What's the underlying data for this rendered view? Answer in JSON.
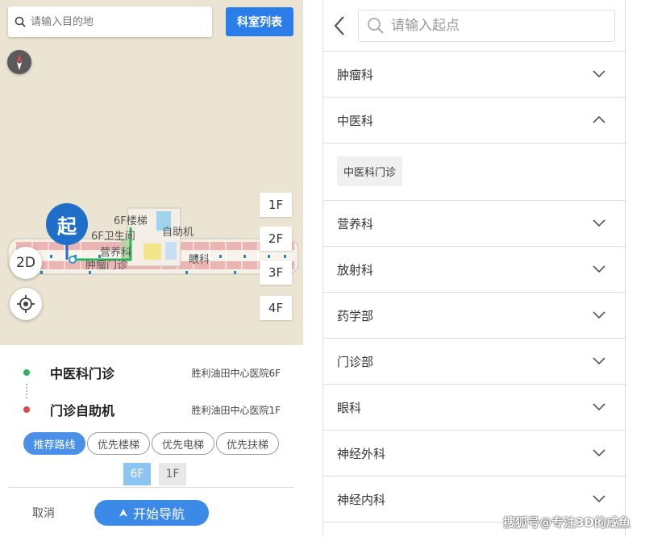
{
  "map": {
    "search_placeholder": "请输入目的地",
    "dept_list_button": "科室列表",
    "floor_buttons": [
      "1F",
      "2F",
      "3F",
      "4F"
    ],
    "mode_button": "2D",
    "start_marker": "起",
    "labels": {
      "stairs_6f": "6F楼梯",
      "restroom_6f": "6F卫生间",
      "nutrition": "营养科",
      "kiosk": "自助机",
      "tumor": "肿瘤门诊",
      "eye": "眼科"
    }
  },
  "route": {
    "start": {
      "name": "中医科门诊",
      "place": "胜利油田中心医院6F",
      "color": "#2bb35a"
    },
    "end": {
      "name": "门诊自助机",
      "place": "胜利油田中心医院1F",
      "color": "#e04848"
    },
    "preferences": [
      "推荐路线",
      "优先楼梯",
      "优先电梯",
      "优先扶梯"
    ],
    "selected_preference": "推荐路线",
    "floors": [
      "6F",
      "1F"
    ],
    "selected_floor": "6F",
    "cancel_label": "取消",
    "start_nav_label": "开始导航"
  },
  "picker": {
    "search_placeholder": "请输入起点",
    "departments": [
      {
        "label": "肿瘤科",
        "expanded": false
      },
      {
        "label": "中医科",
        "expanded": true,
        "children": [
          "中医科门诊"
        ]
      },
      {
        "label": "营养科",
        "expanded": false
      },
      {
        "label": "放射科",
        "expanded": false
      },
      {
        "label": "药学部",
        "expanded": false
      },
      {
        "label": "门诊部",
        "expanded": false
      },
      {
        "label": "眼科",
        "expanded": false
      },
      {
        "label": "神经外科",
        "expanded": false
      },
      {
        "label": "神经内科",
        "expanded": false
      }
    ]
  },
  "watermark": "搜狐号@专注3D的咸鱼",
  "colors": {
    "accent": "#2b7de9",
    "map_bg": "#ebe4d3"
  }
}
